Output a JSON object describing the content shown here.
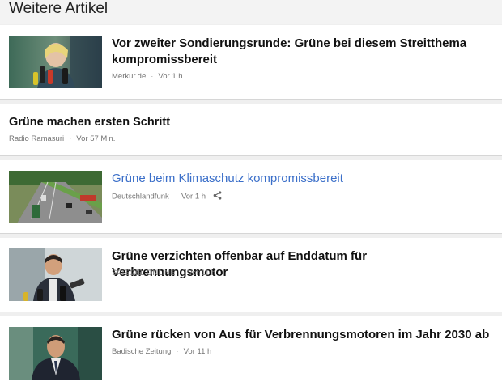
{
  "section": {
    "title": "Weitere Artikel"
  },
  "articles": [
    {
      "title": "Vor zweiter Sondierungsrunde: Grüne bei diesem Streitthema kompromissbereit",
      "source": "Merkur.de",
      "time": "Vor 1 h",
      "thumbnail": "politician-woman-microphones"
    },
    {
      "title": "Grüne machen ersten Schritt",
      "source": "Radio Ramasuri",
      "time": "Vor 57 Min."
    },
    {
      "title": "Grüne beim Klimaschutz kompromissbereit",
      "source": "Deutschlandfunk",
      "time": "Vor 1 h",
      "thumbnail": "highway-traffic",
      "share_icon": "share-icon"
    },
    {
      "title": "Grüne verzichten offenbar auf Enddatum für Verbrennungsmotor",
      "source": "SPIEGEL ONLINE",
      "time": "Vor 11 h",
      "thumbnail": "politician-man-microphones"
    },
    {
      "title": "Grüne rücken von Aus für Verbrennungsmotoren im Jahr 2030 ab",
      "source": "Badische Zeitung",
      "time": "Vor 11 h",
      "thumbnail": "politician-man-portrait"
    }
  ],
  "colors": {
    "link": "#3b6fc9",
    "background": "#efefef",
    "card": "#ffffff"
  }
}
